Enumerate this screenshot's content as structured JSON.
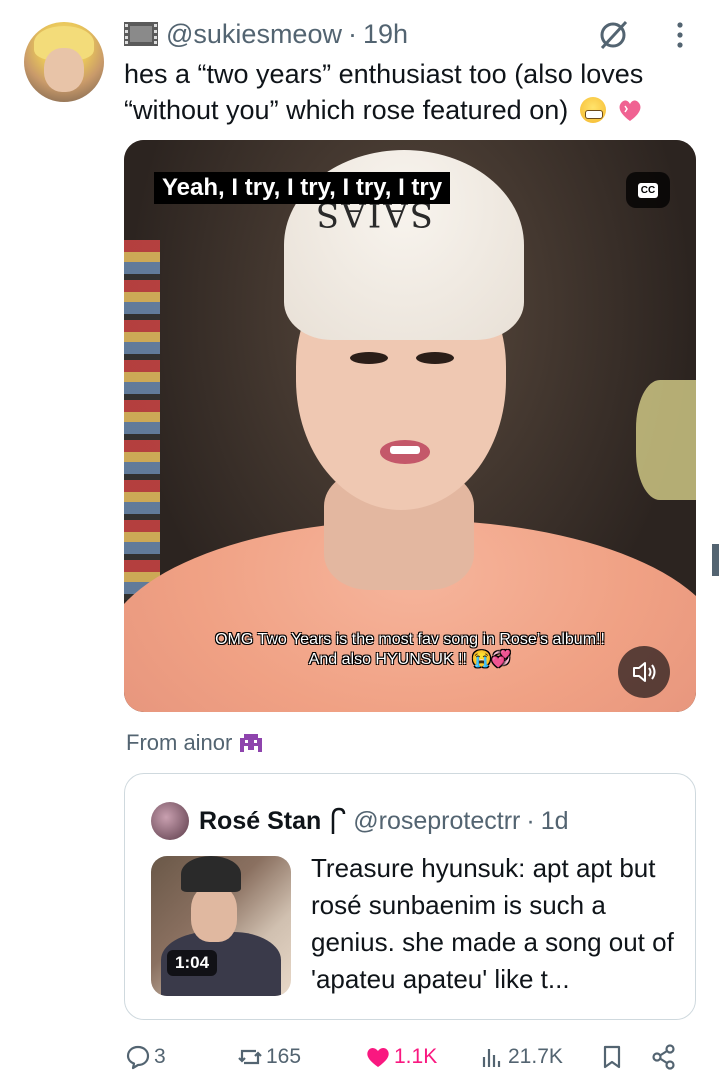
{
  "tweet": {
    "handle": "@sukiesmeow",
    "separator": "·",
    "time": "19h",
    "text": "hes a “two years” enthusiast too (also loves “without you” which rose featured on)",
    "emojis": [
      "grin-emoji",
      "heart-emoji"
    ]
  },
  "video": {
    "caption_top": "Yeah, I try, I try, I try, I try",
    "beanie_text": "SAIAS",
    "cc_label": "CC",
    "overlay_line1": "OMG Two Years is the most fav song in Rose’s album!!",
    "overlay_line2": "And also HYUNSUK !!"
  },
  "from": {
    "label": "From ainor"
  },
  "quote": {
    "name": "Rosé Stan",
    "handle": "@roseprotectrr",
    "separator": "·",
    "time": "1d",
    "video_duration": "1:04",
    "text": "Treasure hyunsuk: apt apt but rosé sunbaenim is such a genius. she made a song out of 'apateu apateu' like t..."
  },
  "actions": {
    "replies": "3",
    "retweets": "165",
    "likes": "1.1K",
    "views": "21.7K"
  },
  "colors": {
    "text_primary": "#0f1419",
    "text_secondary": "#536471",
    "like_pink": "#f91880",
    "border": "#cfd9de"
  }
}
